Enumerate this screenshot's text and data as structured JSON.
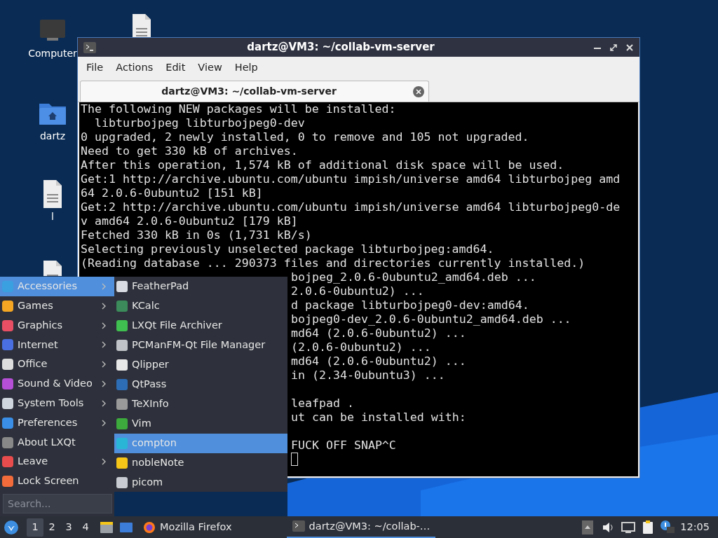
{
  "desktop_icons": [
    {
      "kind": "computer",
      "label": "Computer"
    },
    {
      "kind": "file"
    },
    {
      "kind": "home",
      "label": "dartz"
    },
    {
      "kind": "file",
      "label": "l"
    },
    {
      "kind": "file"
    }
  ],
  "terminal_window": {
    "title": "dartz@VM3: ~/collab-vm-server",
    "menu": [
      "File",
      "Actions",
      "Edit",
      "View",
      "Help"
    ],
    "tab": {
      "title": "dartz@VM3: ~/collab-vm-server"
    },
    "lines": [
      {
        "kind": "text",
        "text": "The following NEW packages will be installed:"
      },
      {
        "kind": "text",
        "text": "  libturbojpeg libturbojpeg0-dev"
      },
      {
        "kind": "text",
        "text": "0 upgraded, 2 newly installed, 0 to remove and 105 not upgraded."
      },
      {
        "kind": "text",
        "text": "Need to get 330 kB of archives."
      },
      {
        "kind": "text",
        "text": "After this operation, 1,574 kB of additional disk space will be used."
      },
      {
        "kind": "text",
        "text": "Get:1 http://archive.ubuntu.com/ubuntu impish/universe amd64 libturbojpeg amd"
      },
      {
        "kind": "text",
        "text": "64 2.0.6-0ubuntu2 [151 kB]"
      },
      {
        "kind": "text",
        "text": "Get:2 http://archive.ubuntu.com/ubuntu impish/universe amd64 libturbojpeg0-de"
      },
      {
        "kind": "text",
        "text": "v amd64 2.0.6-0ubuntu2 [179 kB]"
      },
      {
        "kind": "text",
        "text": "Fetched 330 kB in 0s (1,731 kB/s)"
      },
      {
        "kind": "text",
        "text": "Selecting previously unselected package libturbojpeg:amd64."
      },
      {
        "kind": "text",
        "text": "(Reading database ... 290373 files and directories currently installed.)"
      },
      {
        "kind": "tail",
        "text": "bojpeg_2.0.6-0ubuntu2_amd64.deb ..."
      },
      {
        "kind": "tail",
        "text": "2.0.6-0ubuntu2) ..."
      },
      {
        "kind": "tail",
        "text": "d package libturbojpeg0-dev:amd64."
      },
      {
        "kind": "tail",
        "text": "bojpeg0-dev_2.0.6-0ubuntu2_amd64.deb ..."
      },
      {
        "kind": "tail",
        "text": "md64 (2.0.6-0ubuntu2) ..."
      },
      {
        "kind": "tail",
        "text": "(2.0.6-0ubuntu2) ..."
      },
      {
        "kind": "tail",
        "text": "md64 (2.0.6-0ubuntu2) ..."
      },
      {
        "kind": "tail",
        "text": "in (2.34-0ubuntu3) ..."
      },
      {
        "kind": "blank"
      },
      {
        "kind": "tail",
        "text": "leafpad ."
      },
      {
        "kind": "tail",
        "text": "ut can be installed with:"
      },
      {
        "kind": "blank"
      },
      {
        "kind": "tail",
        "text": "FUCK OFF SNAP^C"
      },
      {
        "kind": "cursor"
      }
    ]
  },
  "start_menu": {
    "categories": [
      {
        "label": "Accessories",
        "has_submenu": true,
        "selected": true
      },
      {
        "label": "Games",
        "has_submenu": true,
        "selected": false
      },
      {
        "label": "Graphics",
        "has_submenu": true,
        "selected": false
      },
      {
        "label": "Internet",
        "has_submenu": true,
        "selected": false
      },
      {
        "label": "Office",
        "has_submenu": true,
        "selected": false
      },
      {
        "label": "Sound & Video",
        "has_submenu": true,
        "selected": false
      },
      {
        "label": "System Tools",
        "has_submenu": true,
        "selected": false
      },
      {
        "label": "Preferences",
        "has_submenu": true,
        "selected": false
      },
      {
        "label": "About LXQt",
        "has_submenu": false,
        "selected": false
      },
      {
        "label": "Leave",
        "has_submenu": true,
        "selected": false
      },
      {
        "label": "Lock Screen",
        "has_submenu": false,
        "selected": false
      }
    ],
    "search": {
      "placeholder": "Search..."
    },
    "submenu": [
      {
        "label": "FeatherPad",
        "selected": false
      },
      {
        "label": "KCalc",
        "selected": false
      },
      {
        "label": "LXQt File Archiver",
        "selected": false
      },
      {
        "label": "PCManFM-Qt File Manager",
        "selected": false
      },
      {
        "label": "Qlipper",
        "selected": false
      },
      {
        "label": "QtPass",
        "selected": false
      },
      {
        "label": "TeXInfo",
        "selected": false
      },
      {
        "label": "Vim",
        "selected": false
      },
      {
        "label": "compton",
        "selected": true
      },
      {
        "label": "nobleNote",
        "selected": false
      },
      {
        "label": "picom",
        "selected": false
      }
    ]
  },
  "taskbar": {
    "desktops": [
      {
        "label": "1",
        "selected": true
      },
      {
        "label": "2",
        "selected": false
      },
      {
        "label": "3",
        "selected": false
      },
      {
        "label": "4",
        "selected": false
      }
    ],
    "tasks": [
      {
        "label": "Mozilla Firefox",
        "selected": false
      },
      {
        "label": "dartz@VM3: ~/collab-…",
        "selected": true
      }
    ],
    "clock": "12:05"
  }
}
